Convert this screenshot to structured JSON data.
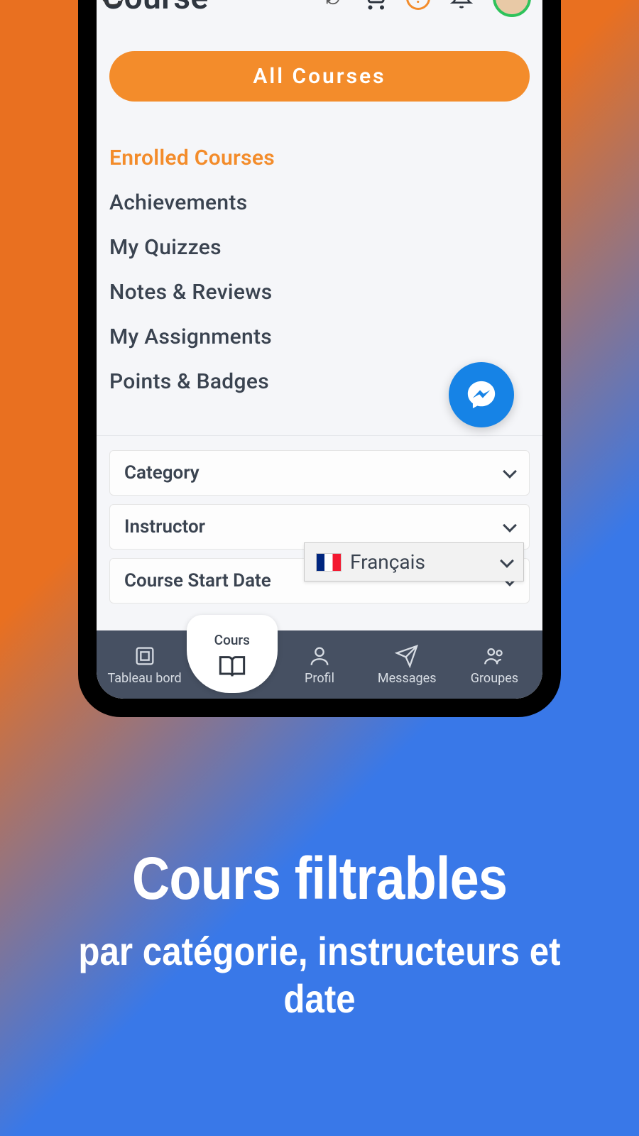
{
  "header": {
    "title": "Course"
  },
  "topIcons": {
    "help": "?"
  },
  "primaryButton": {
    "label": "All Courses"
  },
  "menu": [
    {
      "label": "Enrolled Courses",
      "active": true
    },
    {
      "label": "Achievements",
      "active": false
    },
    {
      "label": "My Quizzes",
      "active": false
    },
    {
      "label": "Notes & Reviews",
      "active": false
    },
    {
      "label": "My Assignments",
      "active": false
    },
    {
      "label": "Points & Badges",
      "active": false
    }
  ],
  "filters": {
    "category": "Category",
    "instructor": "Instructor",
    "courseStartDate": "Course Start Date"
  },
  "languagePicker": {
    "selected": "Français"
  },
  "bottomNav": {
    "dashboard": "Tableau bord",
    "courses": "Cours",
    "profile": "Profil",
    "messages": "Messages",
    "groups": "Groupes"
  },
  "promo": {
    "headline": "Cours filtrables",
    "subline": "par catégorie, instructeurs et date"
  }
}
